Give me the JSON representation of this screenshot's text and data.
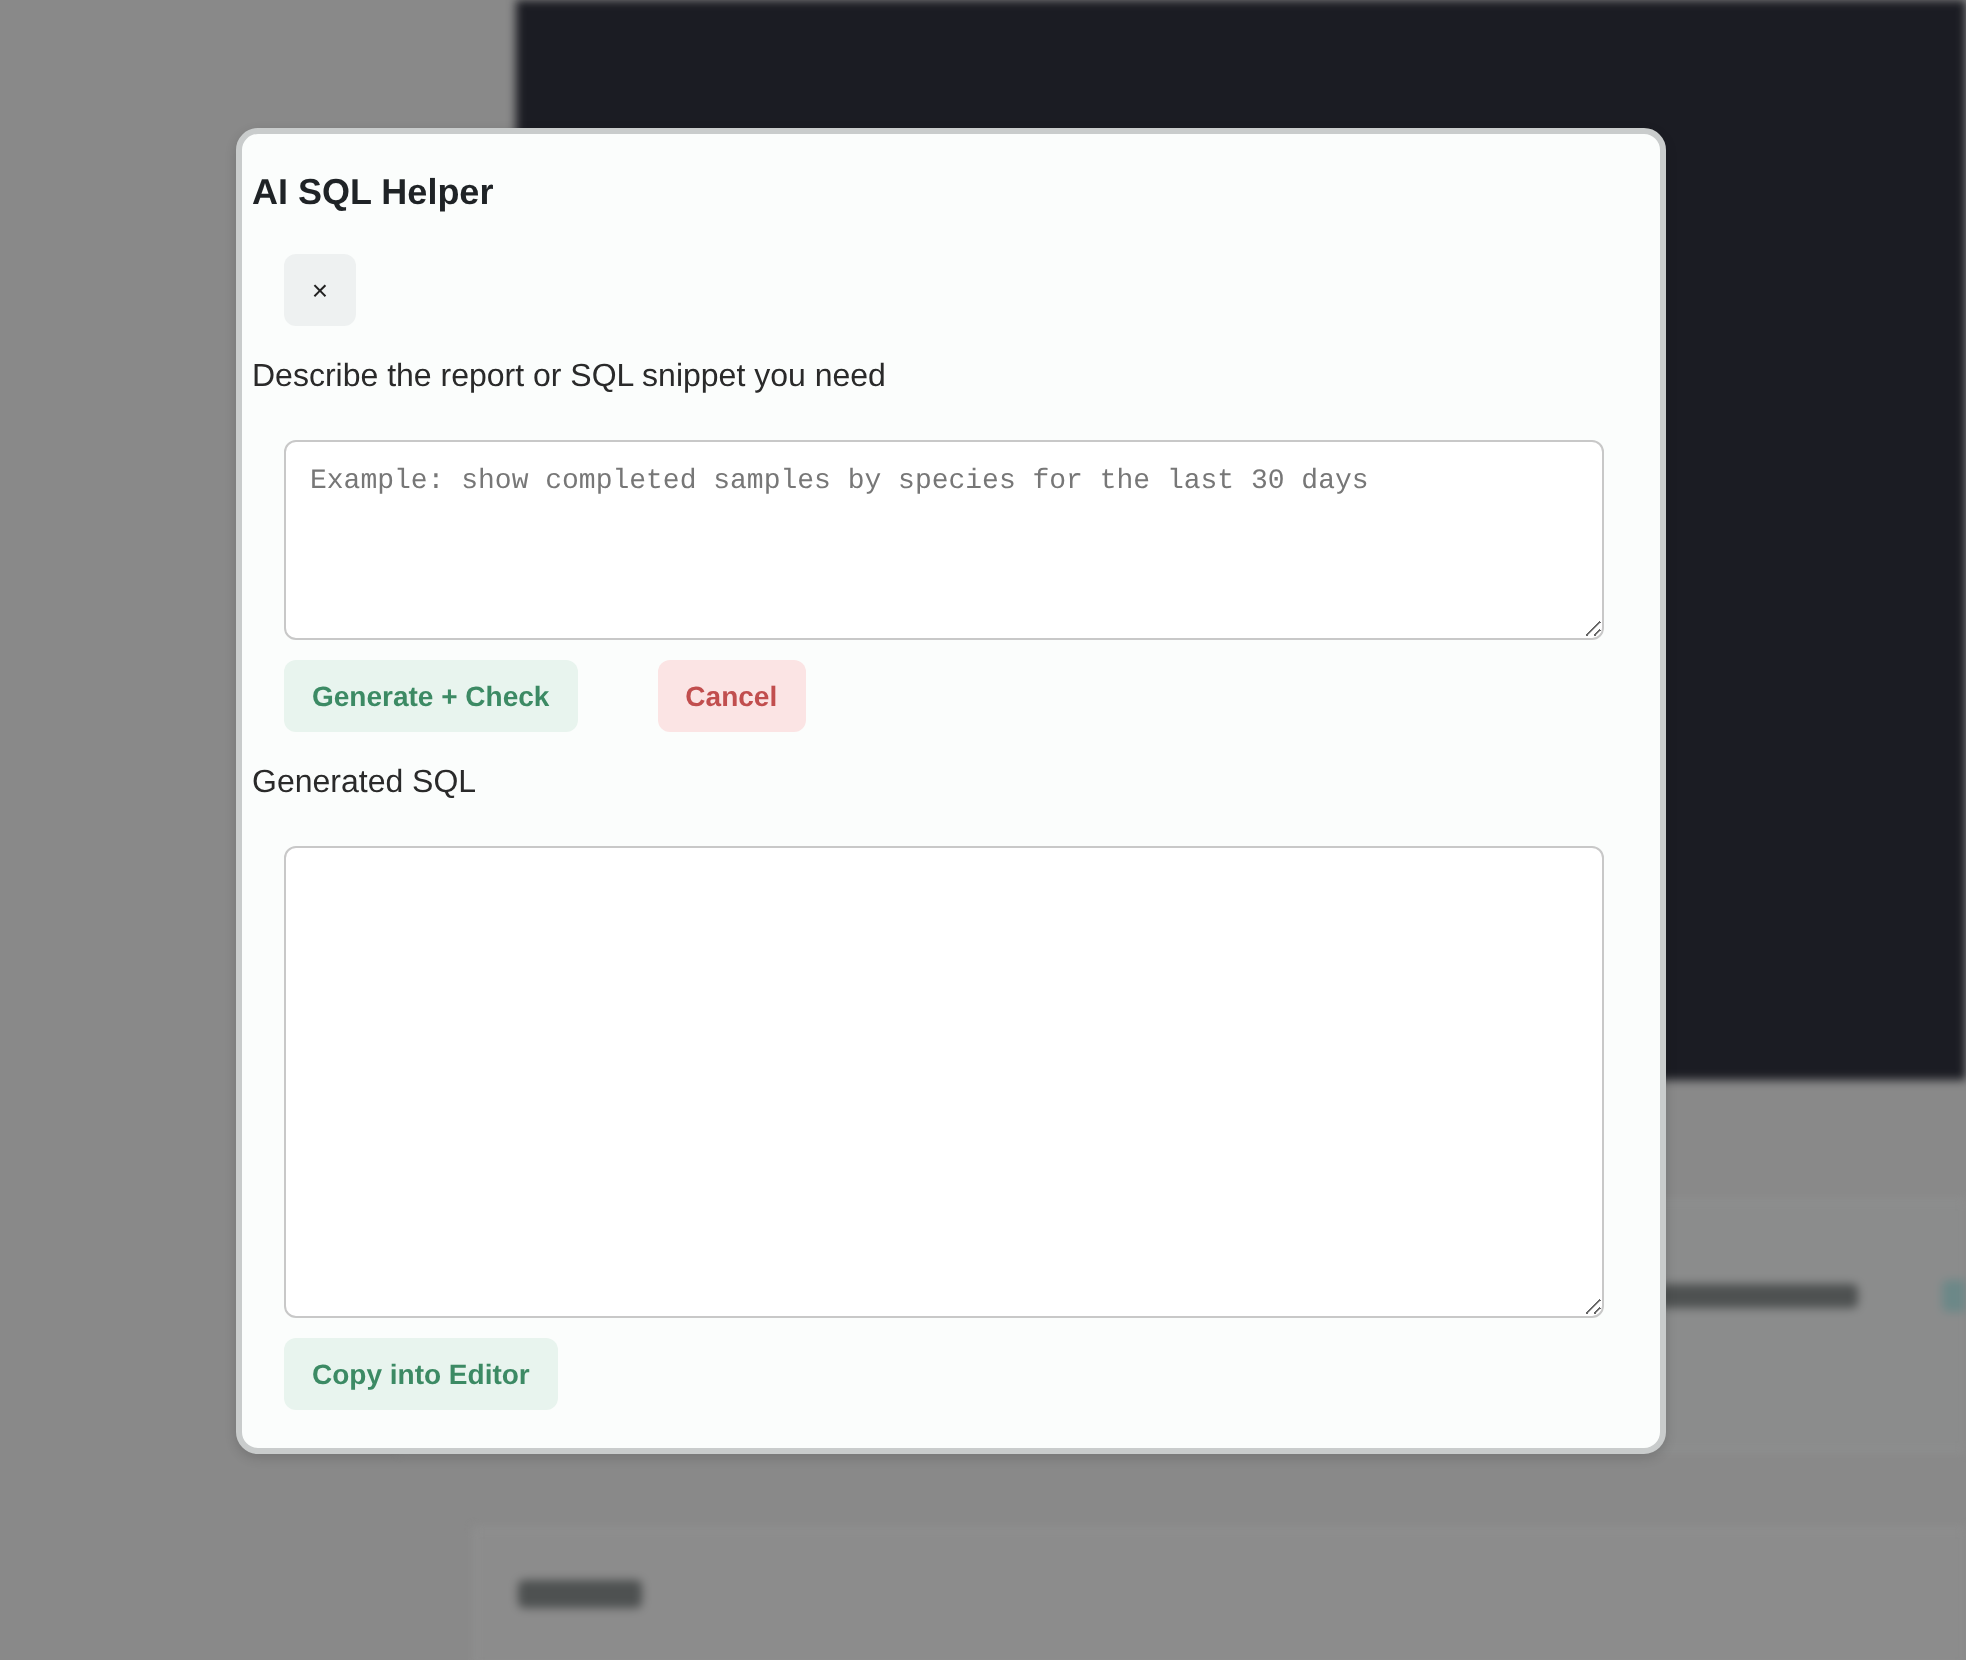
{
  "dialog": {
    "title": "AI SQL Helper",
    "close_button": "×",
    "prompt_label": "Describe the report or SQL snippet you need",
    "prompt_field": {
      "placeholder": "Example: show completed samples by species for the last 30 days"
    },
    "actions": [
      {
        "label": "Generate + Check",
        "kind": "primary"
      },
      {
        "label": "Cancel",
        "kind": "danger"
      }
    ],
    "output_label": "Generated SQL",
    "footer_actions": [
      {
        "label": "Copy into Editor",
        "kind": "primary"
      }
    ]
  }
}
